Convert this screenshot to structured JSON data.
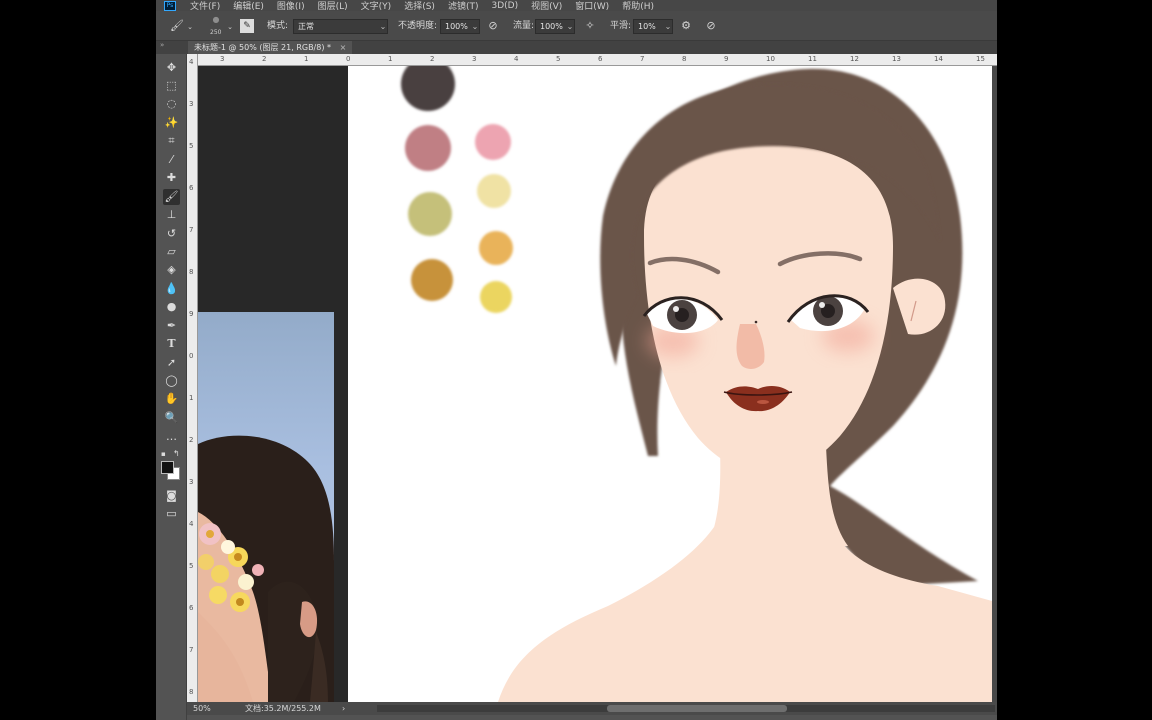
{
  "menu": {
    "items": [
      "文件(F)",
      "编辑(E)",
      "图像(I)",
      "图层(L)",
      "文字(Y)",
      "选择(S)",
      "滤镜(T)",
      "3D(D)",
      "视图(V)",
      "窗口(W)",
      "帮助(H)"
    ]
  },
  "options": {
    "brush_size": "250",
    "mode_label": "模式:",
    "mode_value": "正常",
    "opacity_label": "不透明度:",
    "opacity_value": "100%",
    "flow_label": "流量:",
    "flow_value": "100%",
    "smoothing_label": "平滑:",
    "smoothing_value": "10%"
  },
  "document": {
    "tab_title": "未标题-1 @ 50% (图层 21, RGB/8) *",
    "close_glyph": "×"
  },
  "rulers": {
    "top_ticks": [
      "3",
      "2",
      "1",
      "0",
      "1",
      "2",
      "3",
      "4",
      "5",
      "6",
      "7",
      "8",
      "9",
      "10",
      "11",
      "12",
      "13",
      "14",
      "15"
    ],
    "left_ticks": [
      "4",
      "3",
      "5",
      "6",
      "7",
      "8",
      "9",
      "0",
      "1",
      "2",
      "3",
      "4",
      "5",
      "6",
      "7",
      "8"
    ]
  },
  "status": {
    "zoom": "50%",
    "doc_size": "文档:35.2M/255.2M",
    "arrow": "›"
  },
  "palette": {
    "swatches": [
      "#4a3f40",
      "#c07f84",
      "#eda4b1",
      "#c5c07a",
      "#f0e2a4",
      "#c7923a",
      "#e9b35a",
      "#ebd560"
    ]
  },
  "illustration": {
    "hair": "#6b5448",
    "skin": "#fbe1d1",
    "lips": "#8a2f1e"
  },
  "icons": {
    "tools": [
      "move-icon",
      "marquee-icon",
      "lasso-icon",
      "magic-wand-icon",
      "crop-icon",
      "eyedropper-icon",
      "healing-icon",
      "brush-icon",
      "stamp-icon",
      "history-brush-icon",
      "eraser-icon",
      "bucket-icon",
      "blur-icon",
      "dodge-icon",
      "pen-icon",
      "type-icon",
      "path-select-icon",
      "ellipse-icon",
      "hand-icon",
      "zoom-icon",
      "more-icon"
    ]
  }
}
